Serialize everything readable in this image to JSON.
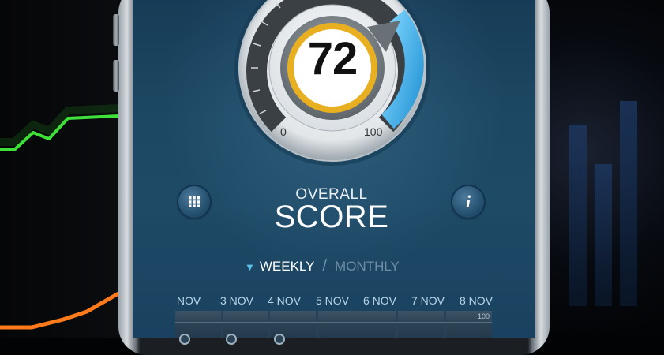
{
  "gauge": {
    "score": "72",
    "min_label": "0",
    "max_label": "100",
    "value": 72,
    "max": 100
  },
  "title": {
    "line1": "OVERALL",
    "line2": "SCORE"
  },
  "buttons": {
    "grid_icon": "grid-icon",
    "info_icon": "info-icon",
    "info_glyph": "i"
  },
  "tabs": {
    "selected": "WEEKLY",
    "separator": "/",
    "other": "MONTHLY"
  },
  "chart_header": {
    "dates": [
      "NOV",
      "3 NOV",
      "4 NOV",
      "5 NOV",
      "6 NOV",
      "7 NOV",
      "8 NOV"
    ],
    "max_label": "100"
  },
  "colors": {
    "accent": "#5cc3ee",
    "ring": "#e8b020",
    "screen_bg": "#1e4a66"
  }
}
